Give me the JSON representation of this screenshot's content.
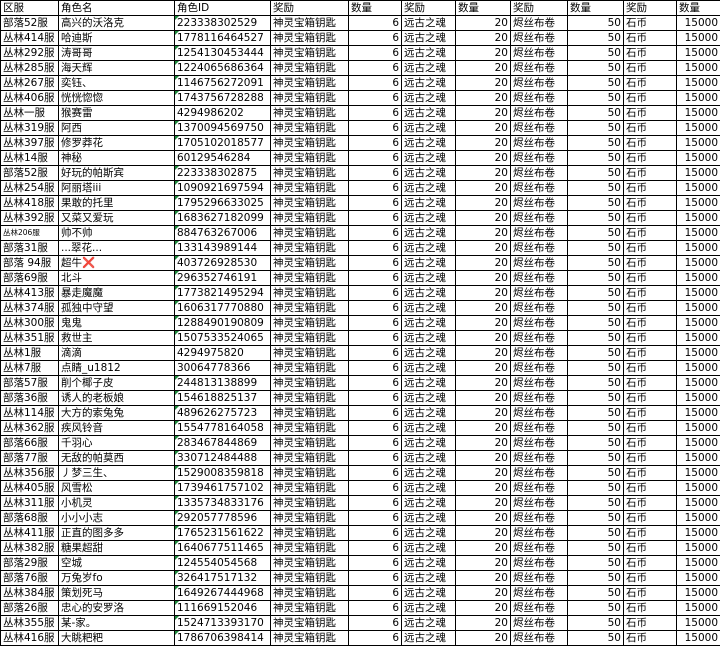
{
  "headers": [
    "区服",
    "角色名",
    "角色ID",
    "奖励",
    "数量",
    "奖励",
    "数量",
    "奖励",
    "数量",
    "奖励",
    "数量"
  ],
  "rows": [
    [
      "部落52服",
      "高兴的沃洛克",
      "223338302529",
      "神灵宝箱钥匙",
      "6",
      "远古之魂",
      "20",
      "烬丝布卷",
      "50",
      "石币",
      "15000"
    ],
    [
      "丛林414服",
      "哈迪斯",
      "1778116464527",
      "神灵宝箱钥匙",
      "6",
      "远古之魂",
      "20",
      "烬丝布卷",
      "50",
      "石币",
      "15000"
    ],
    [
      "丛林292服",
      "涛哥哥",
      "1254130453444",
      "神灵宝箱钥匙",
      "6",
      "远古之魂",
      "20",
      "烬丝布卷",
      "50",
      "石币",
      "15000"
    ],
    [
      "丛林285服",
      "海天辉",
      "1224065686364",
      "神灵宝箱钥匙",
      "6",
      "远古之魂",
      "20",
      "烬丝布卷",
      "50",
      "石币",
      "15000"
    ],
    [
      "丛林267服",
      "奕钰、",
      "1146756272091",
      "神灵宝箱钥匙",
      "6",
      "远古之魂",
      "20",
      "烬丝布卷",
      "50",
      "石币",
      "15000"
    ],
    [
      "丛林406服",
      "恍恍惚惚",
      "1743756728288",
      "神灵宝箱钥匙",
      "6",
      "远古之魂",
      "20",
      "烬丝布卷",
      "50",
      "石币",
      "15000"
    ],
    [
      "丛林一服",
      "猴赛雷",
      "4294986202",
      "神灵宝箱钥匙",
      "6",
      "远古之魂",
      "20",
      "烬丝布卷",
      "50",
      "石币",
      "15000"
    ],
    [
      "丛林319服",
      "阿西",
      "1370094569750",
      "神灵宝箱钥匙",
      "6",
      "远古之魂",
      "20",
      "烬丝布卷",
      "50",
      "石币",
      "15000"
    ],
    [
      "丛林397服",
      "修罗莽花",
      "1705102018577",
      "神灵宝箱钥匙",
      "6",
      "远古之魂",
      "20",
      "烬丝布卷",
      "50",
      "石币",
      "15000"
    ],
    [
      "丛林14服",
      "神秘",
      "60129546284",
      "神灵宝箱钥匙",
      "6",
      "远古之魂",
      "20",
      "烬丝布卷",
      "50",
      "石币",
      "15000"
    ],
    [
      "部落52服",
      "好玩的帕斯宾",
      "223338302875",
      "神灵宝箱钥匙",
      "6",
      "远古之魂",
      "20",
      "烬丝布卷",
      "50",
      "石币",
      "15000"
    ],
    [
      "丛林254服",
      "阿丽塔iii",
      "1090921697594",
      "神灵宝箱钥匙",
      "6",
      "远古之魂",
      "20",
      "烬丝布卷",
      "50",
      "石币",
      "15000"
    ],
    [
      "丛林418服",
      "果敢的托里",
      "1795296633025",
      "神灵宝箱钥匙",
      "6",
      "远古之魂",
      "20",
      "烬丝布卷",
      "50",
      "石币",
      "15000"
    ],
    [
      "丛林392服",
      "又菜又爱玩",
      "1683627182099",
      "神灵宝箱钥匙",
      "6",
      "远古之魂",
      "20",
      "烬丝布卷",
      "50",
      "石币",
      "15000"
    ],
    [
      "丛林206服",
      "帅不帅",
      "884763267006",
      "神灵宝箱钥匙",
      "6",
      "远古之魂",
      "20",
      "烬丝布卷",
      "50",
      "石币",
      "15000"
    ],
    [
      "部落31服",
      "...翠花...",
      "133143989144",
      "神灵宝箱钥匙",
      "6",
      "远古之魂",
      "20",
      "烬丝布卷",
      "50",
      "石币",
      "15000"
    ],
    [
      "部落 94服",
      "超牛❌",
      "403726928530",
      "神灵宝箱钥匙",
      "6",
      "远古之魂",
      "20",
      "烬丝布卷",
      "50",
      "石币",
      "15000"
    ],
    [
      "部落69服",
      "北斗",
      "296352746191",
      "神灵宝箱钥匙",
      "6",
      "远古之魂",
      "20",
      "烬丝布卷",
      "50",
      "石币",
      "15000"
    ],
    [
      "丛林413服",
      "暴走魔魔",
      "1773821495294",
      "神灵宝箱钥匙",
      "6",
      "远古之魂",
      "20",
      "烬丝布卷",
      "50",
      "石币",
      "15000"
    ],
    [
      "丛林374服",
      "孤独中守望",
      "1606317770880",
      "神灵宝箱钥匙",
      "6",
      "远古之魂",
      "20",
      "烬丝布卷",
      "50",
      "石币",
      "15000"
    ],
    [
      "丛林300服",
      "鬼鬼",
      "1288490190809",
      "神灵宝箱钥匙",
      "6",
      "远古之魂",
      "20",
      "烬丝布卷",
      "50",
      "石币",
      "15000"
    ],
    [
      "丛林351服",
      "救世主",
      "1507533524065",
      "神灵宝箱钥匙",
      "6",
      "远古之魂",
      "20",
      "烬丝布卷",
      "50",
      "石币",
      "15000"
    ],
    [
      "丛林1服",
      "滴滴",
      "4294975820",
      "神灵宝箱钥匙",
      "6",
      "远古之魂",
      "20",
      "烬丝布卷",
      "50",
      "石币",
      "15000"
    ],
    [
      "丛林7服",
      "点睛_u1812",
      "30064778366",
      "神灵宝箱钥匙",
      "6",
      "远古之魂",
      "20",
      "烬丝布卷",
      "50",
      "石币",
      "15000"
    ],
    [
      "部落57服",
      "削个椰子皮",
      "244813138899",
      "神灵宝箱钥匙",
      "6",
      "远古之魂",
      "20",
      "烬丝布卷",
      "50",
      "石币",
      "15000"
    ],
    [
      "部落36服",
      "诱人的老板娘",
      "154618825137",
      "神灵宝箱钥匙",
      "6",
      "远古之魂",
      "20",
      "烬丝布卷",
      "50",
      "石币",
      "15000"
    ],
    [
      "丛林114服",
      "大方的索兔兔",
      "489626275723",
      "神灵宝箱钥匙",
      "6",
      "远古之魂",
      "20",
      "烬丝布卷",
      "50",
      "石币",
      "15000"
    ],
    [
      "丛林362服",
      "疾风铃音",
      "1554778164058",
      "神灵宝箱钥匙",
      "6",
      "远古之魂",
      "20",
      "烬丝布卷",
      "50",
      "石币",
      "15000"
    ],
    [
      "部落66服",
      "千羽心",
      "283467844869",
      "神灵宝箱钥匙",
      "6",
      "远古之魂",
      "20",
      "烬丝布卷",
      "50",
      "石币",
      "15000"
    ],
    [
      "部落77服",
      "无敌的帕莫西",
      "330712484488",
      "神灵宝箱钥匙",
      "6",
      "远古之魂",
      "20",
      "烬丝布卷",
      "50",
      "石币",
      "15000"
    ],
    [
      "丛林356服",
      "丿梦三生、",
      "1529008359818",
      "神灵宝箱钥匙",
      "6",
      "远古之魂",
      "20",
      "烬丝布卷",
      "50",
      "石币",
      "15000"
    ],
    [
      "丛林405服",
      "风雪松",
      "1739461757102",
      "神灵宝箱钥匙",
      "6",
      "远古之魂",
      "20",
      "烬丝布卷",
      "50",
      "石币",
      "15000"
    ],
    [
      "丛林311服",
      "小机灵",
      "1335734833176",
      "神灵宝箱钥匙",
      "6",
      "远古之魂",
      "20",
      "烬丝布卷",
      "50",
      "石币",
      "15000"
    ],
    [
      "部落68服",
      "小小小志",
      "292057778596",
      "神灵宝箱钥匙",
      "6",
      "远古之魂",
      "20",
      "烬丝布卷",
      "50",
      "石币",
      "15000"
    ],
    [
      "丛林411服",
      "正直的图多多",
      "1765231561622",
      "神灵宝箱钥匙",
      "6",
      "远古之魂",
      "20",
      "烬丝布卷",
      "50",
      "石币",
      "15000"
    ],
    [
      "丛林382服",
      "糖果超甜",
      "1640677511465",
      "神灵宝箱钥匙",
      "6",
      "远古之魂",
      "20",
      "烬丝布卷",
      "50",
      "石币",
      "15000"
    ],
    [
      "部落29服",
      "空城",
      "124554054568",
      "神灵宝箱钥匙",
      "6",
      "远古之魂",
      "20",
      "烬丝布卷",
      "50",
      "石币",
      "15000"
    ],
    [
      "部落76服",
      "万兔岁fo",
      "326417517132",
      "神灵宝箱钥匙",
      "6",
      "远古之魂",
      "20",
      "烬丝布卷",
      "50",
      "石币",
      "15000"
    ],
    [
      "丛林384服",
      "策划死马",
      "1649267444968",
      "神灵宝箱钥匙",
      "6",
      "远古之魂",
      "20",
      "烬丝布卷",
      "50",
      "石币",
      "15000"
    ],
    [
      "部落26服",
      "忠心的安罗洛",
      "111669152046",
      "神灵宝箱钥匙",
      "6",
      "远古之魂",
      "20",
      "烬丝布卷",
      "50",
      "石币",
      "15000"
    ],
    [
      "丛林355服",
      "某-家。",
      "1524713393170",
      "神灵宝箱钥匙",
      "6",
      "远古之魂",
      "20",
      "烬丝布卷",
      "50",
      "石币",
      "15000"
    ],
    [
      "丛林416服",
      "大眺粑粑",
      "1786706398414",
      "神灵宝箱钥匙",
      "6",
      "远古之魂",
      "20",
      "烬丝布卷",
      "50",
      "石币",
      "15000"
    ]
  ],
  "colors": {
    "grid": "#000000",
    "text": "#000000",
    "id_marker": "#1e8a3c"
  }
}
